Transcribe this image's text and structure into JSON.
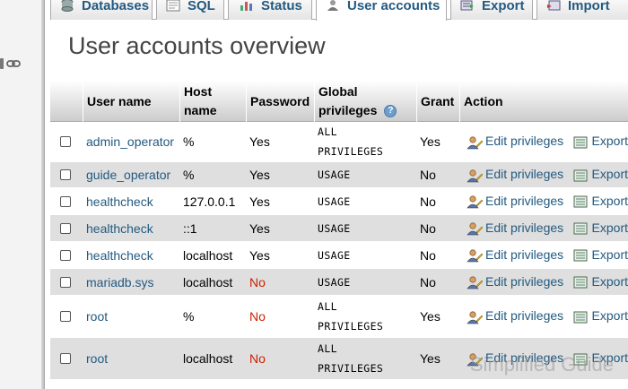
{
  "tabs": [
    {
      "label": "Databases",
      "icon": "database-icon"
    },
    {
      "label": "SQL",
      "icon": "sql-icon"
    },
    {
      "label": "Status",
      "icon": "status-icon"
    },
    {
      "label": "User accounts",
      "icon": "users-icon",
      "active": true
    },
    {
      "label": "Export",
      "icon": "export-icon"
    },
    {
      "label": "Import",
      "icon": "import-icon"
    }
  ],
  "page_title": "User accounts overview",
  "table": {
    "headers": {
      "user": "User name",
      "host_line1": "Host",
      "host_line2": "name",
      "password": "Password",
      "privs_line1": "Global",
      "privs_line2": "privileges",
      "grant": "Grant",
      "action": "Action"
    },
    "action_labels": {
      "edit": "Edit privileges",
      "export": "Export"
    },
    "rows": [
      {
        "user": "admin_operator",
        "host": "%",
        "password": "Yes",
        "privs": "ALL PRIVILEGES",
        "grant": "Yes"
      },
      {
        "user": "guide_operator",
        "host": "%",
        "password": "Yes",
        "privs": "USAGE",
        "grant": "No"
      },
      {
        "user": "healthcheck",
        "host": "127.0.0.1",
        "password": "Yes",
        "privs": "USAGE",
        "grant": "No"
      },
      {
        "user": "healthcheck",
        "host": "::1",
        "password": "Yes",
        "privs": "USAGE",
        "grant": "No"
      },
      {
        "user": "healthcheck",
        "host": "localhost",
        "password": "Yes",
        "privs": "USAGE",
        "grant": "No"
      },
      {
        "user": "mariadb.sys",
        "host": "localhost",
        "password": "No",
        "privs": "USAGE",
        "grant": "No"
      },
      {
        "user": "root",
        "host": "%",
        "password": "No",
        "privs": "ALL PRIVILEGES",
        "grant": "Yes"
      },
      {
        "user": "root",
        "host": "localhost",
        "password": "No",
        "privs": "ALL PRIVILEGES",
        "grant": "Yes"
      }
    ]
  },
  "watermark": "Simplified Guide",
  "colors": {
    "link": "#235a81",
    "no_password": "#cc2200",
    "row_alt": "#dfdfdf"
  }
}
